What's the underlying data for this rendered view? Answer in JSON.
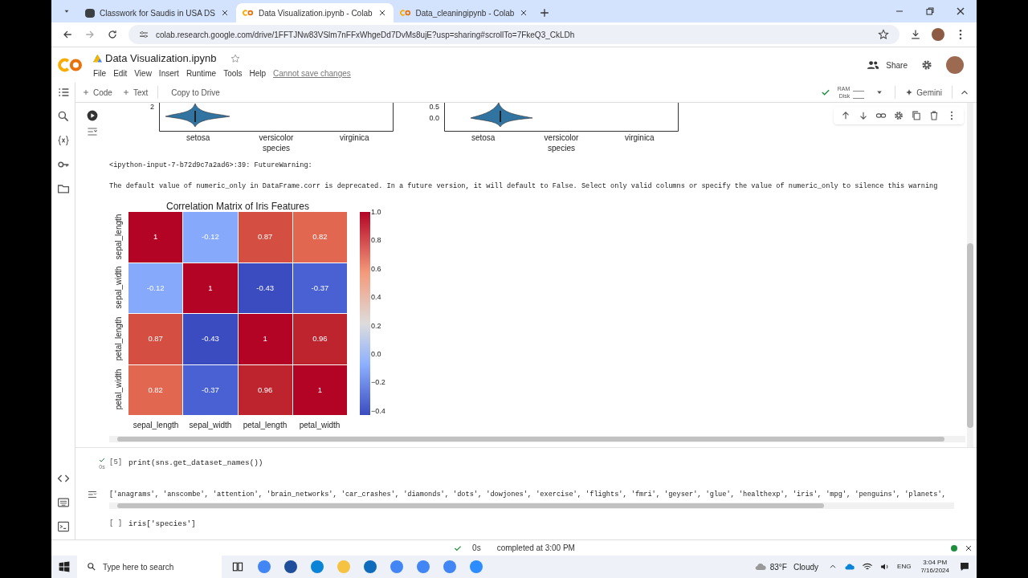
{
  "browser": {
    "tabs": [
      {
        "title": "Classwork for Saudis in USA DS",
        "selected": false,
        "kind": "classroom"
      },
      {
        "title": "Data Visualization.ipynb - Colab",
        "selected": true,
        "kind": "colab"
      },
      {
        "title": "Data_cleaningipynb - Colab",
        "selected": false,
        "kind": "colab"
      }
    ],
    "url": "colab.research.google.com/drive/1FFTJNw83VSlm7nFFxWhgeDd7DvMs8ujE?usp=sharing#scrollTo=7FkeQ3_CkLDh"
  },
  "notebook": {
    "title": "Data Visualization.ipynb",
    "menu": [
      "File",
      "Edit",
      "View",
      "Insert",
      "Runtime",
      "Tools",
      "Help"
    ],
    "save_notice": "Cannot save changes",
    "share": "Share",
    "toolbar": [
      "Code",
      "Text"
    ],
    "copy": "Copy to Drive",
    "ram": "RAM",
    "disk": "Disk",
    "gemini": "Gemini"
  },
  "output": {
    "violins": [
      {
        "yticks": [
          "2"
        ],
        "categories": [
          "setosa",
          "versicolor",
          "virginica"
        ],
        "xlabel": "species"
      },
      {
        "yticks": [
          "0.5",
          "0.0"
        ],
        "categories": [
          "setosa",
          "versicolor",
          "virginica"
        ],
        "xlabel": "species"
      }
    ],
    "warning": "<ipython-input-7-b72d9c7a2ad6>:39: FutureWarning:",
    "message": "The default value of numeric_only in DataFrame.corr is deprecated. In a future version, it will default to False. Select only valid columns or specify the value of numeric_only to silence this warning",
    "heatmap": {
      "title": "Correlation Matrix of Iris Features",
      "ylabels": [
        "sepal_length",
        "sepal_width",
        "petal_length",
        "petal_width"
      ],
      "xlabels": [
        "sepal_length",
        "sepal_width",
        "petal_length",
        "petal_width"
      ],
      "cells": [
        [
          {
            "value": "1",
            "color": "#b40426"
          },
          {
            "value": "-0.12",
            "color": "#86a9fc"
          },
          {
            "value": "0.87",
            "color": "#d44e41"
          },
          {
            "value": "0.82",
            "color": "#e16751"
          }
        ],
        [
          {
            "value": "-0.12",
            "color": "#86a9fc"
          },
          {
            "value": "1",
            "color": "#b40426"
          },
          {
            "value": "-0.43",
            "color": "#3b4cc0"
          },
          {
            "value": "-0.37",
            "color": "#4961d2"
          }
        ],
        [
          {
            "value": "0.87",
            "color": "#d44e41"
          },
          {
            "value": "-0.43",
            "color": "#3b4cc0"
          },
          {
            "value": "1",
            "color": "#b40426"
          },
          {
            "value": "0.96",
            "color": "#be242e"
          }
        ],
        [
          {
            "value": "0.82",
            "color": "#e16751"
          },
          {
            "value": "-0.37",
            "color": "#4961d2"
          },
          {
            "value": "0.96",
            "color": "#be242e"
          },
          {
            "value": "1",
            "color": "#b40426"
          }
        ]
      ],
      "colorbar_ticks": [
        "1.0",
        "0.8",
        "0.6",
        "0.4",
        "0.2",
        "0.0",
        "−0.2",
        "−0.4"
      ]
    }
  },
  "cells": [
    {
      "count": "[5]",
      "code": "print(sns.get_dataset_names())",
      "done": true,
      "time": "0s",
      "result": "['anagrams', 'anscombe', 'attention', 'brain_networks', 'car_crashes', 'diamonds', 'dots', 'dowjones', 'exercise', 'flights', 'fmri', 'geyser', 'glue', 'healthexp', 'iris', 'mpg', 'penguins', 'planets',"
    },
    {
      "count": "[ ]",
      "code": "iris['species']",
      "done": false
    }
  ],
  "status": {
    "time": "0s",
    "message": "completed at 3:00 PM"
  },
  "taskbar": {
    "search": "Type here to search",
    "temperature": "83°F",
    "weather": "Cloudy",
    "language": "ENG",
    "time": "3:04 PM",
    "date": "7/16/2024"
  }
}
